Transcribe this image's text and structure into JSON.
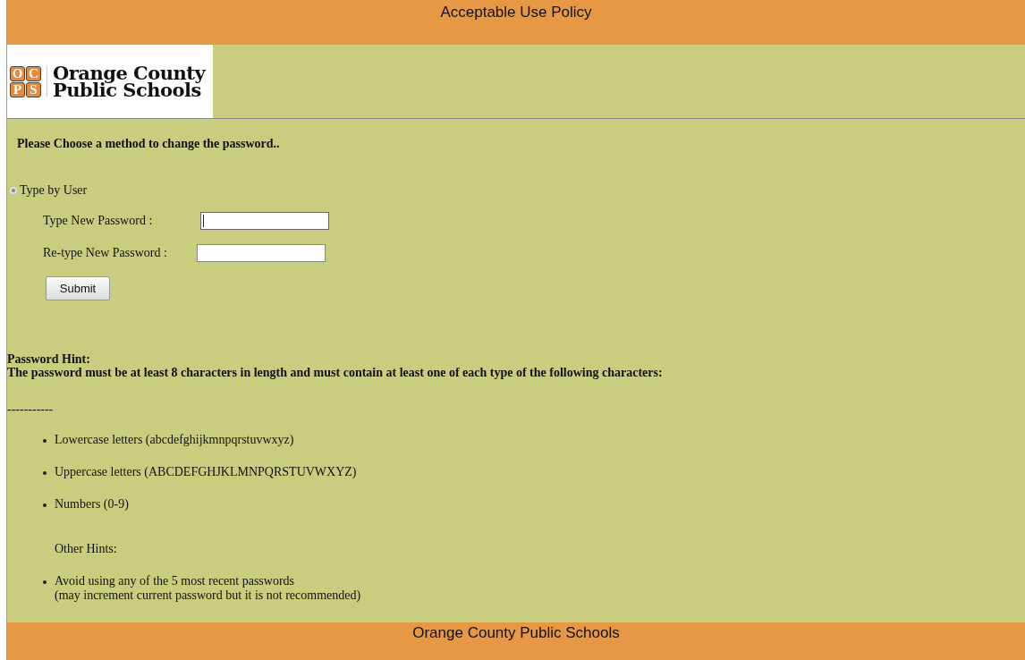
{
  "header": {
    "title": "Acceptable Use Policy"
  },
  "logo": {
    "letters": [
      "O",
      "C",
      "P",
      "S"
    ],
    "lines": [
      "Orange County",
      "Public Schools"
    ]
  },
  "form": {
    "heading": "Please Choose a method to change the password..",
    "method": {
      "label": "Type by User",
      "selected": true
    },
    "fields": [
      {
        "label": "Type New Password :",
        "focused": true
      },
      {
        "label": "Re-type New Password :",
        "focused": false
      }
    ],
    "submit": "Submit"
  },
  "hint": {
    "title": "Password Hint:",
    "text": "The password must be at least 8 characters in length and must contain at least one of each type of the following characters:",
    "separator": "-----------",
    "items": [
      {
        "kind": "bullet",
        "text": "Lowercase letters (abcdefghijkmnpqrstuvwxyz)"
      },
      {
        "kind": "bullet",
        "text": "Uppercase letters (ABCDEFGHJKLMNPQRSTUVWXYZ)"
      },
      {
        "kind": "bullet",
        "text": "Numbers (0-9)"
      },
      {
        "kind": "heading",
        "text": "Other Hints:"
      },
      {
        "kind": "bullet",
        "text": "Avoid using any of the 5 most recent passwords\n(may increment current password but it is not recommended)"
      }
    ]
  },
  "footer": {
    "title": "Orange County Public Schools"
  }
}
